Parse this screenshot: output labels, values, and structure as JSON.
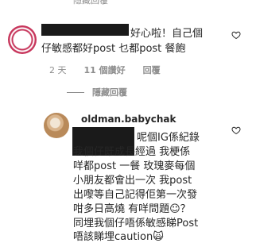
{
  "top_hidden_text": "隱藏回覆",
  "comment1": {
    "lines": [
      "好心啦！自己個",
      "仔敏感都好post 乜都post 餐飽"
    ],
    "time": "2 天",
    "likes": "11 個讚好",
    "reply_label": "回覆"
  },
  "view_replies_label": "隱藏回覆",
  "comment2": {
    "username": "oldman.babychak",
    "lines": [
      "呢個IG係紀錄",
      "我個仔既成長經過 我梗係",
      "咩都post 一餐 玫瑰麥每個",
      "小朋友都會出一次 我post",
      "出嚟等自己記得佢第一次發",
      "咁多日高燒 有咩問題☺？",
      "同埋我個仔唔係敏感睇Post",
      "唔該睇埋caution🙀"
    ]
  },
  "icons": [
    "heart-icon"
  ]
}
